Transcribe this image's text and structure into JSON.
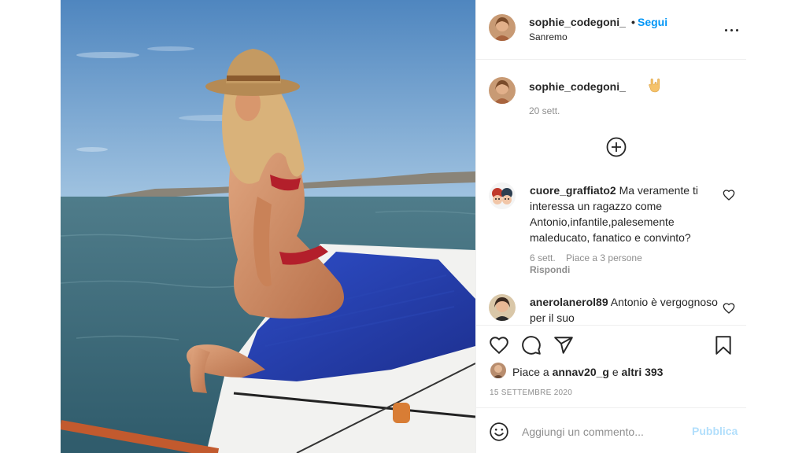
{
  "post": {
    "author": {
      "username": "sophie_codegoni_",
      "location": "Sanremo",
      "separator": "•",
      "follow_label": "Segui"
    },
    "caption": {
      "username": "sophie_codegoni_",
      "emoji": "🤟",
      "date": "20 sett."
    },
    "comments": [
      {
        "username": "cuore_graffiato2",
        "text": "Ma veramente ti interessa un ragazzo come Antonio,infantile,palesemente maleducato, fanatico e convinto?",
        "date": "6 sett.",
        "likes": "Piace a 3 persone",
        "reply_label": "Rispondi"
      },
      {
        "username": "anerolanerol89",
        "text": "Antonio è vergognoso per il suo"
      }
    ],
    "likes": {
      "prefix": "Piace a ",
      "user": "annav20_g",
      "middle": " e ",
      "others": "altri 393"
    },
    "date": "15 SETTEMBRE 2020",
    "add_comment": {
      "placeholder": "Aggiungi un commento...",
      "publish_label": "Pubblica"
    },
    "icons": {
      "more": "more-options-icon",
      "load_more": "plus-circle-icon",
      "like": "heart-icon",
      "comment": "comment-icon",
      "share": "paper-plane-icon",
      "save": "bookmark-icon",
      "emoji": "smiley-icon"
    },
    "colors": {
      "accent": "#0095f6",
      "publish_disabled": "#b2dffc",
      "secondary_text": "#8e8e8e",
      "border": "#efefef"
    }
  }
}
